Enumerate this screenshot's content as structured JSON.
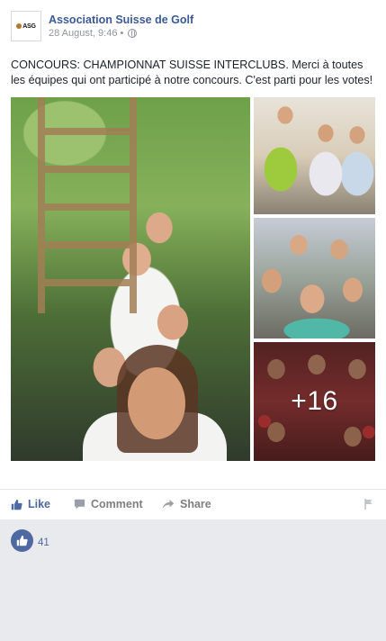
{
  "post": {
    "page_name": "Association Suisse de Golf",
    "avatar_text": "ASG",
    "timestamp": "28 August, 9:46",
    "separator": "•",
    "privacy_icon": "globe-icon",
    "text": "CONCOURS: CHAMPIONNAT SUISSE INTERCLUBS. Merci à toutes les équipes qui ont participé à notre concours. C'est parti pour les votes!",
    "photos": {
      "main_description_icon": "photo",
      "more_count": "+16"
    }
  },
  "actions": {
    "like_label": "Like",
    "comment_label": "Comment",
    "share_label": "Share"
  },
  "reactions": {
    "count": "41"
  },
  "colors": {
    "brand_blue": "#3b5998",
    "action_blue": "#4e69a2",
    "muted": "#90949c",
    "footer_bg": "#e9eaed"
  }
}
